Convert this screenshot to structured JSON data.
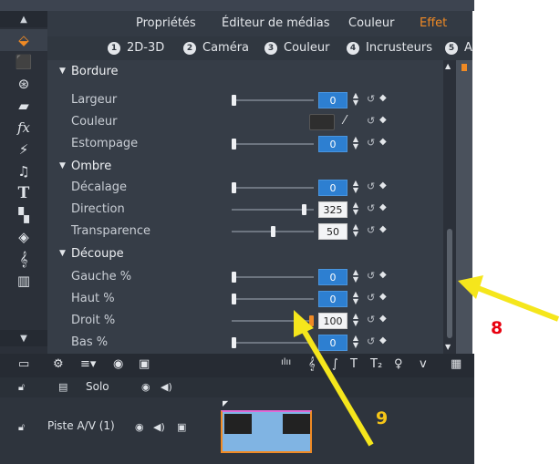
{
  "main_tabs": [
    {
      "label": "Propriétés",
      "active": false
    },
    {
      "label": "Éditeur de médias",
      "active": false
    },
    {
      "label": "Couleur",
      "active": false
    },
    {
      "label": "Effet",
      "active": true
    }
  ],
  "sub_tabs": [
    {
      "num": "1",
      "label": "2D-3D"
    },
    {
      "num": "2",
      "label": "Caméra"
    },
    {
      "num": "3",
      "label": "Couleur"
    },
    {
      "num": "4",
      "label": "Incrusteurs"
    },
    {
      "num": "5",
      "label": "A"
    }
  ],
  "sections": {
    "bordure": "Bordure",
    "ombre": "Ombre",
    "decoupe": "Découpe"
  },
  "properties": {
    "largeur": {
      "label": "Largeur",
      "value": "0",
      "level": 0
    },
    "couleur": {
      "label": "Couleur",
      "swatch": "#2e2e2e"
    },
    "estompage": {
      "label": "Estompage",
      "value": "0",
      "level": 0
    },
    "decalage": {
      "label": "Décalage",
      "value": "0",
      "level": 0
    },
    "direction": {
      "label": "Direction",
      "value": "325",
      "level": 0.9
    },
    "transparence": {
      "label": "Transparence",
      "value": "50",
      "level": 0.5
    },
    "gauche": {
      "label": "Gauche %",
      "value": "0",
      "level": 0
    },
    "haut": {
      "label": "Haut %",
      "value": "0",
      "level": 0
    },
    "droit": {
      "label": "Droit %",
      "value": "100",
      "level": 1
    },
    "bas": {
      "label": "Bas %",
      "value": "0",
      "level": 0
    }
  },
  "timeline": {
    "solo_label": "Solo",
    "track_label": "Piste A/V (1)"
  },
  "annotations": {
    "eight": "8",
    "nine": "9"
  },
  "colors": {
    "accent": "#f08a24",
    "value_box": "#2d7fd1",
    "annotation_red": "#e8000f",
    "annotation_yellow": "#f5e61c"
  }
}
